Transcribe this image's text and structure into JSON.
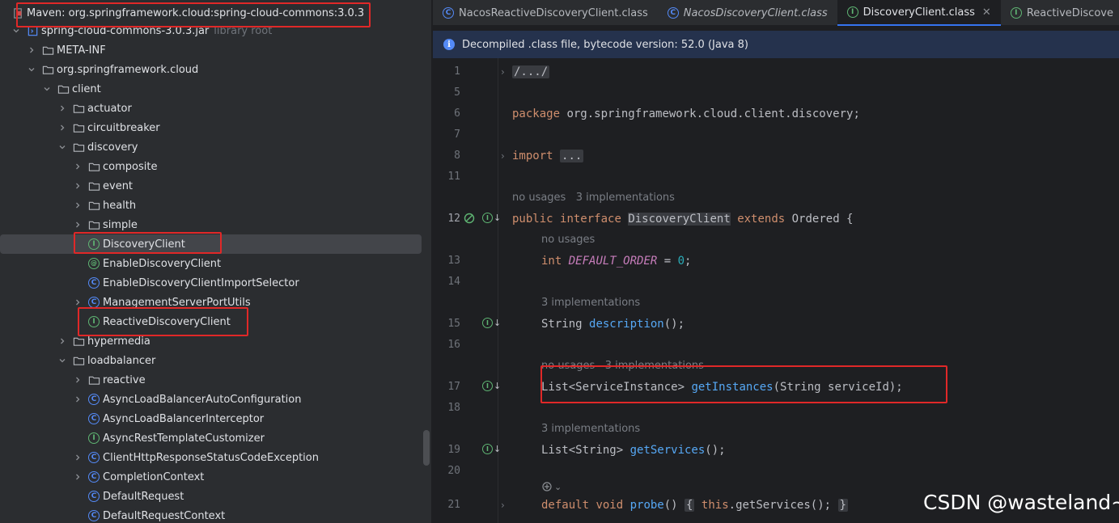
{
  "tree": {
    "maven_root": "Maven: org.springframework.cloud:spring-cloud-commons:3.0.3",
    "jar": {
      "label": "spring-cloud-commons-3.0.3.jar",
      "hint": "library root"
    },
    "items": [
      {
        "label": "META-INF",
        "kind": "folder",
        "depth": 2,
        "expanded": false
      },
      {
        "label": "org.springframework.cloud",
        "kind": "folder",
        "depth": 2,
        "expanded": true
      },
      {
        "label": "client",
        "kind": "folder",
        "depth": 3,
        "expanded": true
      },
      {
        "label": "actuator",
        "kind": "folder",
        "depth": 4,
        "expanded": false
      },
      {
        "label": "circuitbreaker",
        "kind": "folder",
        "depth": 4,
        "expanded": false
      },
      {
        "label": "discovery",
        "kind": "folder",
        "depth": 4,
        "expanded": true
      },
      {
        "label": "composite",
        "kind": "folder",
        "depth": 5,
        "expanded": false
      },
      {
        "label": "event",
        "kind": "folder",
        "depth": 5,
        "expanded": false
      },
      {
        "label": "health",
        "kind": "folder",
        "depth": 5,
        "expanded": false
      },
      {
        "label": "simple",
        "kind": "folder",
        "depth": 5,
        "expanded": false
      },
      {
        "label": "DiscoveryClient",
        "kind": "interface",
        "depth": 5,
        "selected": true
      },
      {
        "label": "EnableDiscoveryClient",
        "kind": "annotation",
        "depth": 5
      },
      {
        "label": "EnableDiscoveryClientImportSelector",
        "kind": "class",
        "depth": 5
      },
      {
        "label": "ManagementServerPortUtils",
        "kind": "class",
        "depth": 5,
        "expanded": false
      },
      {
        "label": "ReactiveDiscoveryClient",
        "kind": "interface",
        "depth": 5
      },
      {
        "label": "hypermedia",
        "kind": "folder",
        "depth": 4,
        "expanded": false
      },
      {
        "label": "loadbalancer",
        "kind": "folder",
        "depth": 4,
        "expanded": true
      },
      {
        "label": "reactive",
        "kind": "folder",
        "depth": 5,
        "expanded": false
      },
      {
        "label": "AsyncLoadBalancerAutoConfiguration",
        "kind": "class",
        "depth": 5,
        "expanded": false
      },
      {
        "label": "AsyncLoadBalancerInterceptor",
        "kind": "class",
        "depth": 5
      },
      {
        "label": "AsyncRestTemplateCustomizer",
        "kind": "interface",
        "depth": 5
      },
      {
        "label": "ClientHttpResponseStatusCodeException",
        "kind": "class",
        "depth": 5,
        "expanded": false
      },
      {
        "label": "CompletionContext",
        "kind": "class",
        "depth": 5,
        "expanded": false
      },
      {
        "label": "DefaultRequest",
        "kind": "class",
        "depth": 5
      },
      {
        "label": "DefaultRequestContext",
        "kind": "class",
        "depth": 5
      }
    ]
  },
  "tabs": [
    {
      "label": "NacosReactiveDiscoveryClient.class",
      "kind": "class",
      "active": false,
      "italic": false
    },
    {
      "label": "NacosDiscoveryClient.class",
      "kind": "class",
      "active": false,
      "italic": true
    },
    {
      "label": "DiscoveryClient.class",
      "kind": "interface",
      "active": true,
      "italic": false
    },
    {
      "label": "ReactiveDiscove",
      "kind": "interface",
      "active": false,
      "italic": false
    }
  ],
  "banner": "Decompiled .class file, bytecode version: 52.0 (Java 8)",
  "editor": {
    "line_numbers": [
      "1",
      "5",
      "6",
      "7",
      "8",
      "11",
      "12",
      "13",
      "14",
      "15",
      "16",
      "17",
      "18",
      "19",
      "20",
      "21"
    ],
    "header_folded": "/.../",
    "package_kw": "package",
    "package_name": " org.springframework.cloud.client.discovery;",
    "import_kw": "import",
    "import_folded": "...",
    "hint_interface": "no usages   3 implementations",
    "decl": {
      "public": "public",
      "interface": "interface",
      "name": "DiscoveryClient",
      "extends": "extends",
      "rest": " Ordered {"
    },
    "hint_const": "no usages",
    "const_line": {
      "type": "int",
      "name": "DEFAULT_ORDER",
      "eq": " = ",
      "value": "0",
      "semi": ";"
    },
    "hint_description": "3 implementations",
    "description_line": {
      "type": "String ",
      "fn": "description",
      "rest": "();"
    },
    "hint_getinstances": "no usages   3 implementations",
    "getinstances_line": {
      "type": "List<ServiceInstance> ",
      "fn": "getInstances",
      "rest": "(String serviceId);"
    },
    "hint_getservices": "3 implementations",
    "getservices_line": {
      "type": "List<String> ",
      "fn": "getServices",
      "rest": "();"
    },
    "probe_line": {
      "default": "default",
      "void": " void ",
      "fn": "probe",
      "paren": "() ",
      "open": "{",
      "this": " this",
      "call": ".getServices(); ",
      "close": "}"
    }
  },
  "watermark": "CSDN @wasteland~"
}
